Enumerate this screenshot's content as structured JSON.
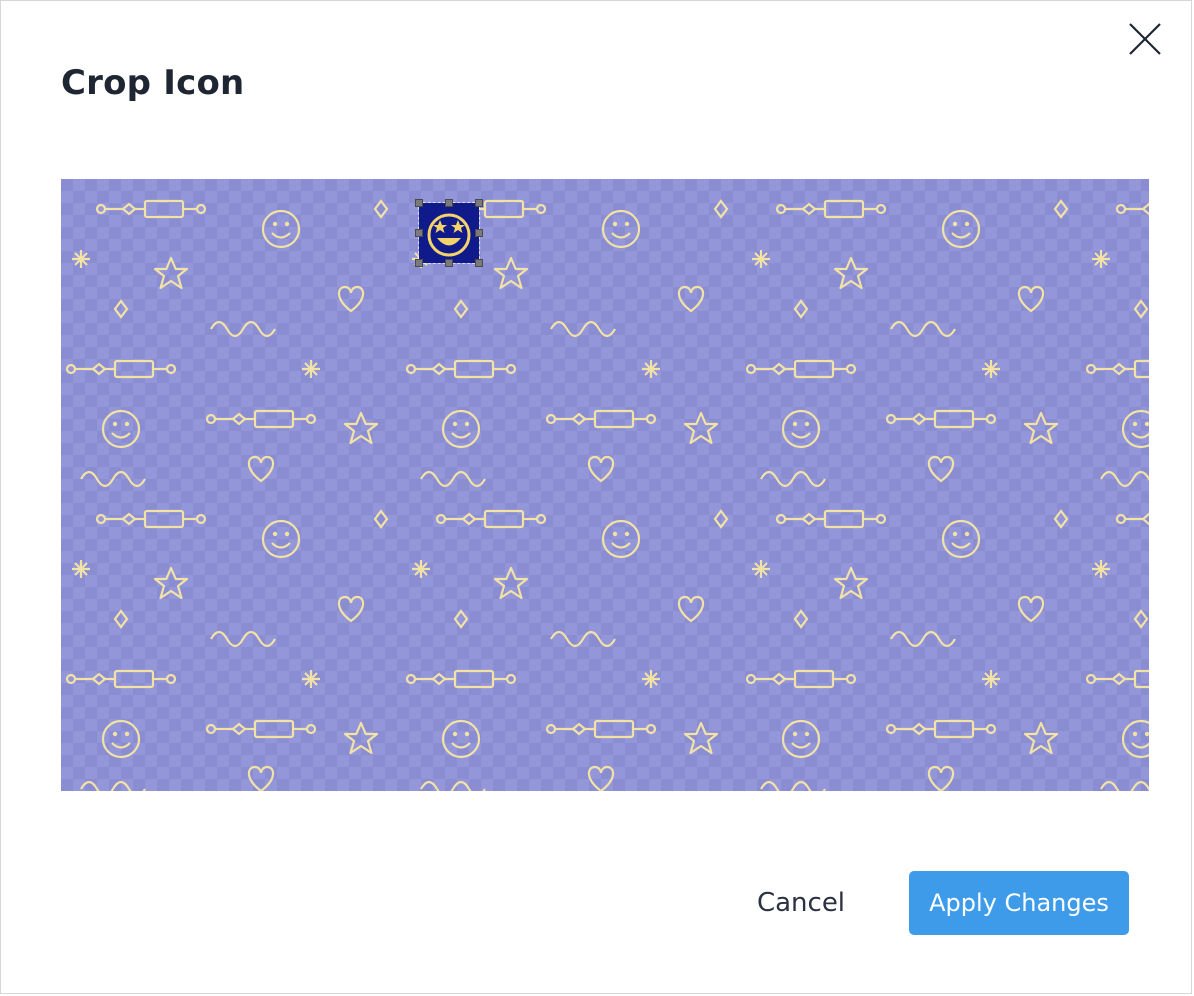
{
  "dialog": {
    "title": "Crop Icon",
    "close_icon": "close-icon"
  },
  "image": {
    "description_icon": "doodle-pattern",
    "background_color": "#8f92d6",
    "doodle_color": "#f3e2a6",
    "selected_icon": "star-struck-emoji-icon",
    "selection_color": "#101a8a"
  },
  "footer": {
    "cancel_label": "Cancel",
    "apply_label": "Apply Changes"
  },
  "colors": {
    "primary": "#3d9be9",
    "title": "#1f2633"
  }
}
